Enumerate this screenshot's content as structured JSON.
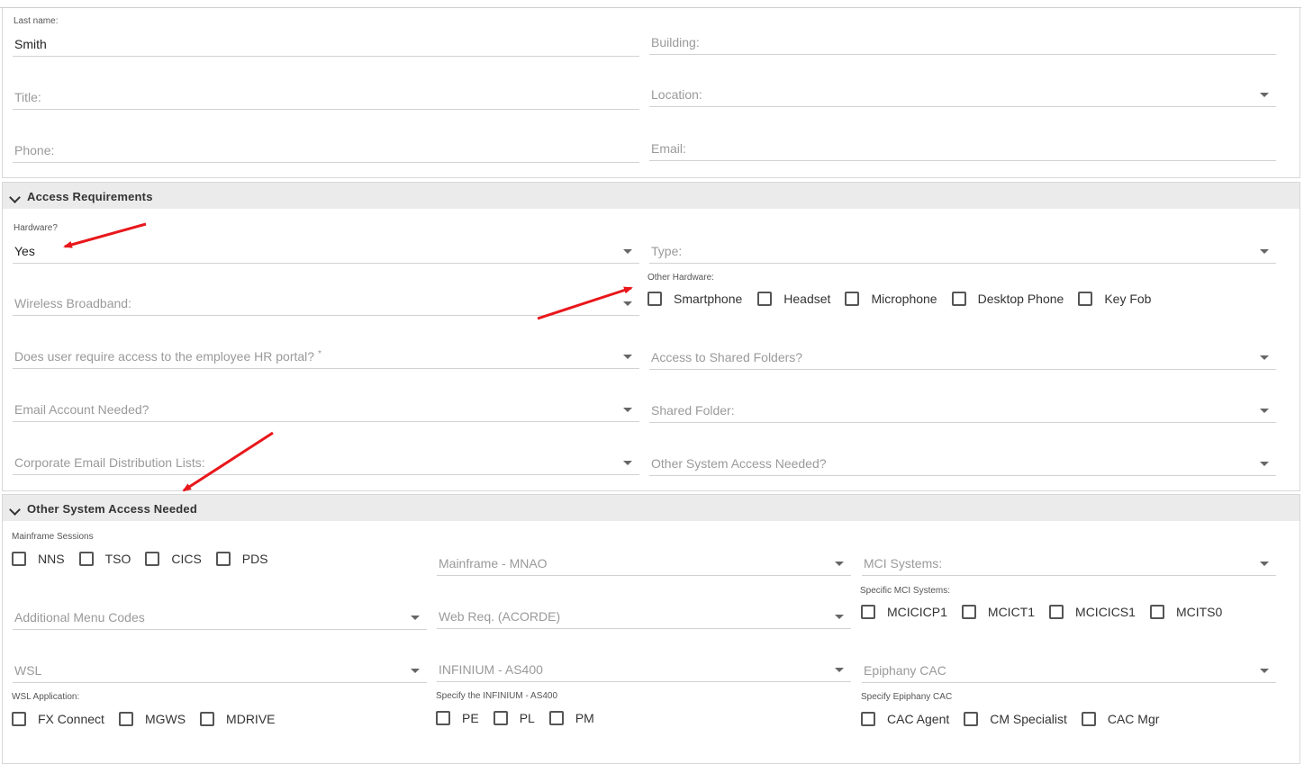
{
  "contact": {
    "last_name_label": "Last name:",
    "last_name_value": "Smith",
    "building_placeholder": "Building:",
    "title_placeholder": "Title:",
    "location_placeholder": "Location:",
    "phone_placeholder": "Phone:",
    "email_placeholder": "Email:"
  },
  "access": {
    "header": "Access Requirements",
    "hardware_label": "Hardware?",
    "hardware_value": "Yes",
    "type_placeholder": "Type:",
    "wireless_placeholder": "Wireless Broadband:",
    "other_hardware_label": "Other Hardware:",
    "other_hardware": [
      "Smartphone",
      "Headset",
      "Microphone",
      "Desktop Phone",
      "Key Fob"
    ],
    "hr_portal_placeholder": "Does user require access to the employee HR portal?",
    "required_mark": "*",
    "shared_folders_placeholder": "Access to Shared Folders?",
    "email_account_placeholder": "Email Account Needed?",
    "shared_folder_placeholder": "Shared Folder:",
    "distribution_placeholder": "Corporate Email Distribution Lists:",
    "other_system_placeholder": "Other System Access Needed?"
  },
  "other_system": {
    "header": "Other System Access Needed",
    "mainframe_label": "Mainframe Sessions",
    "mainframe_options": [
      "NNS",
      "TSO",
      "CICS",
      "PDS"
    ],
    "mnao_placeholder": "Mainframe - MNAO",
    "mci_placeholder": "MCI Systems:",
    "specific_mci_label": "Specific MCI Systems:",
    "specific_mci_options": [
      "MCICICP1",
      "MCICT1",
      "MCICICS1",
      "MCITS0"
    ],
    "menu_codes_placeholder": "Additional Menu Codes",
    "web_req_placeholder": "Web Req. (ACORDE)",
    "wsl_placeholder": "WSL",
    "infinium_placeholder": "INFINIUM - AS400",
    "epiphany_placeholder": "Epiphany CAC",
    "wsl_app_label": "WSL Application:",
    "wsl_app_options": [
      "FX Connect",
      "MGWS",
      "MDRIVE"
    ],
    "infinium_specify_label": "Specify the INFINIUM - AS400",
    "infinium_options": [
      "PE",
      "PL",
      "PM"
    ],
    "epiphany_specify_label": "Specify Epiphany CAC",
    "epiphany_options": [
      "CAC Agent",
      "CM Specialist",
      "CAC Mgr"
    ]
  },
  "colors": {
    "annotation_arrow": "#e8171b",
    "section_header_bg": "#ebebeb"
  }
}
